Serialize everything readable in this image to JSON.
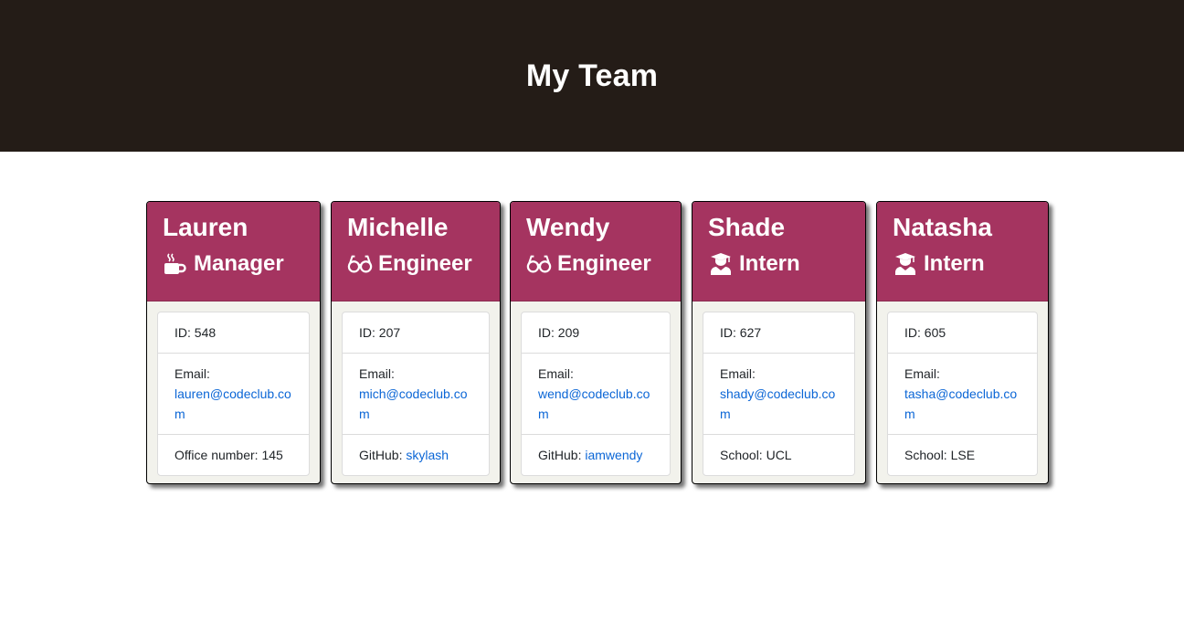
{
  "header": {
    "title": "My Team"
  },
  "colors": {
    "header_bg": "#241c17",
    "card_header_bg": "#a53460",
    "link": "#0b66d6"
  },
  "members": [
    {
      "name": "Lauren",
      "role": "Manager",
      "role_icon": "coffee-mug-icon",
      "id_label": "ID: 548",
      "email_label": "Email:",
      "email": "lauren@codeclub.com",
      "extra_label": "Office number: 145",
      "extra_link": ""
    },
    {
      "name": "Michelle",
      "role": "Engineer",
      "role_icon": "glasses-icon",
      "id_label": "ID: 207",
      "email_label": "Email:",
      "email": "mich@codeclub.com",
      "extra_label": "GitHub: ",
      "extra_link": "skylash"
    },
    {
      "name": "Wendy",
      "role": "Engineer",
      "role_icon": "glasses-icon",
      "id_label": "ID: 209",
      "email_label": "Email:",
      "email": "wend@codeclub.com",
      "extra_label": "GitHub: ",
      "extra_link": "iamwendy"
    },
    {
      "name": "Shade",
      "role": "Intern",
      "role_icon": "graduate-icon",
      "id_label": "ID: 627",
      "email_label": "Email:",
      "email": "shady@codeclub.com",
      "extra_label": "School: UCL",
      "extra_link": ""
    },
    {
      "name": "Natasha",
      "role": "Intern",
      "role_icon": "graduate-icon",
      "id_label": "ID: 605",
      "email_label": "Email:",
      "email": "tasha@codeclub.com",
      "extra_label": "School: LSE",
      "extra_link": ""
    }
  ]
}
